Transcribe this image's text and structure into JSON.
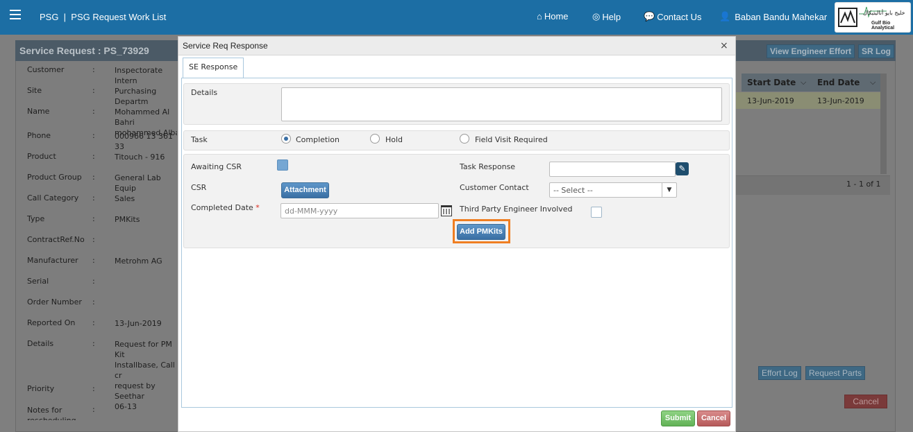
{
  "topbar": {
    "title": "PSG  |  PSG Request Work List",
    "nav_home": "Home",
    "nav_help": "Help",
    "nav_contact": "Contact Us",
    "user_name": "Baban Bandu Mahekar",
    "logo_arabic": "خليج بايو أناليتيكال",
    "logo_english": "Gulf Bio Analytical"
  },
  "background": {
    "title": "Service Request : PS_73929",
    "view_effort_btn": "View Engineer Effort",
    "sr_log_btn": "SR Log",
    "fields": [
      {
        "label": "Customer",
        "value": "Inspectorate Intern"
      },
      {
        "label": "Site",
        "value": "Purchasing Departm"
      },
      {
        "label": "Name",
        "value": "Mohammed Al Bahri\nmohammed.Albahri"
      },
      {
        "label": "Phone",
        "value": "000966 13 361 33"
      },
      {
        "label": "Product",
        "value": "Titouch - 916"
      },
      {
        "label": "Product Group",
        "value": "General Lab Equip"
      },
      {
        "label": "Call Category",
        "value": "Sales"
      },
      {
        "label": "Type",
        "value": "PMKits"
      },
      {
        "label": "ContractRef.No",
        "value": ""
      },
      {
        "label": "Manufacturer",
        "value": "Metrohm AG"
      },
      {
        "label": "Serial",
        "value": ""
      },
      {
        "label": "Order Number",
        "value": ""
      },
      {
        "label": "Reported On",
        "value": "13-Jun-2019"
      },
      {
        "label": "Details",
        "value": "Request for PM Kit\nInstallbase, Call cr\nrequest by Seethar\n06-13"
      },
      {
        "label": "Priority",
        "value": ""
      },
      {
        "label": "Notes for rescheduling",
        "value": ""
      }
    ],
    "grid": {
      "col_start": "Start Date",
      "col_end": "End Date",
      "row_start": "13-Jun-2019",
      "row_end": "13-Jun-2019",
      "pager": "1 - 1 of 1"
    },
    "effort_log_btn": "Effort Log",
    "request_parts_btn": "Request Parts",
    "cancel_btn": "Cancel"
  },
  "modal": {
    "title": "Service Req Response",
    "close": "×",
    "tab_label": "SE Response",
    "details_label": "Details",
    "task_label": "Task",
    "task_options": [
      "Completion",
      "Hold",
      "Field Visit Required"
    ],
    "task_selected": "Completion",
    "awaiting_csr_label": "Awaiting CSR",
    "csr_label": "CSR",
    "attachment_btn": "Attachment",
    "completed_date_label": "Completed Date",
    "required_mark": "*",
    "date_placeholder": "dd-MMM-yyyy",
    "task_response_label": "Task Response",
    "customer_contact_label": "Customer Contact",
    "customer_contact_value": "-- Select --",
    "third_party_label": "Third Party Engineer Involved",
    "add_pmkits_btn": "Add PMKits",
    "submit_btn": "Submit",
    "cancel_btn": "Cancel"
  }
}
